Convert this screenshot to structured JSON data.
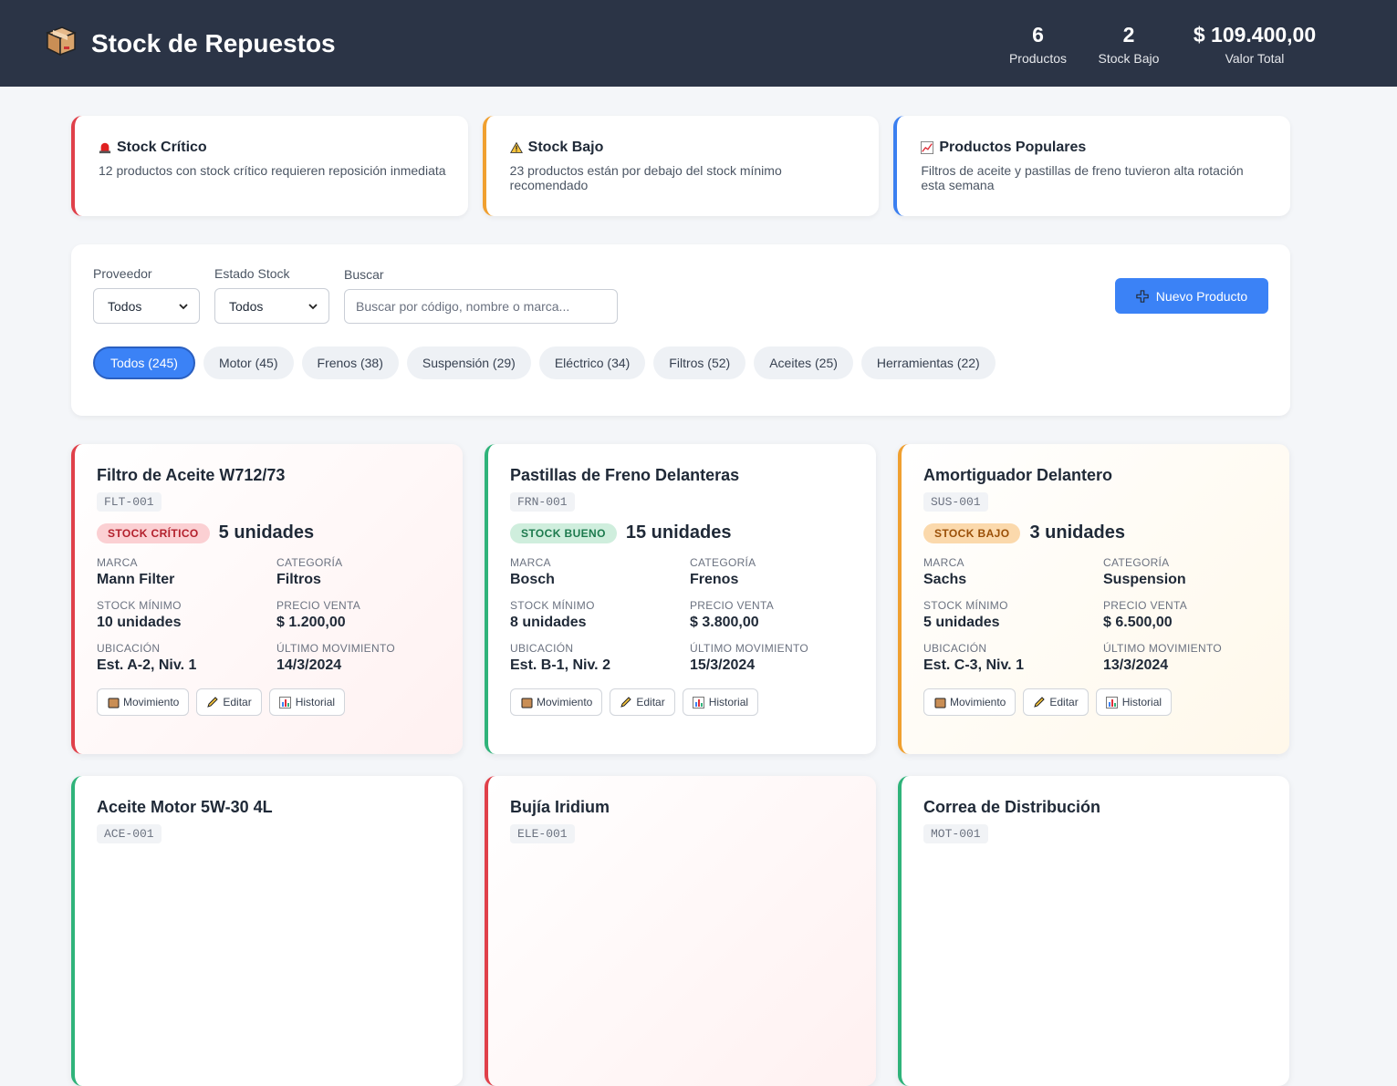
{
  "header": {
    "title": "Stock de Repuestos",
    "stats": [
      {
        "value": "6",
        "label": "Productos"
      },
      {
        "value": "2",
        "label": "Stock Bajo"
      },
      {
        "value": "$ 109.400,00",
        "label": "Valor Total"
      }
    ]
  },
  "alerts": [
    {
      "icon": "siren-icon",
      "title": "Stock Crítico",
      "text": "12 productos con stock crítico requieren reposición inmediata"
    },
    {
      "icon": "warning-icon",
      "title": "Stock Bajo",
      "text": "23 productos están por debajo del stock mínimo recomendado"
    },
    {
      "icon": "chart-up-icon",
      "title": "Productos Populares",
      "text": "Filtros de aceite y pastillas de freno tuvieron alta rotación esta semana"
    }
  ],
  "filters": {
    "provider_label": "Proveedor",
    "provider_value": "Todos",
    "stock_label": "Estado Stock",
    "stock_value": "Todos",
    "search_label": "Buscar",
    "search_placeholder": "Buscar por código, nombre o marca...",
    "new_button": "Nuevo Producto",
    "categories": [
      "Todos (245)",
      "Motor (45)",
      "Frenos (38)",
      "Suspensión (29)",
      "Eléctrico (34)",
      "Filtros (52)",
      "Aceites (25)",
      "Herramientas (22)"
    ]
  },
  "labels": {
    "brand": "MARCA",
    "category": "CATEGORÍA",
    "min_stock": "STOCK MÍNIMO",
    "price": "PRECIO VENTA",
    "location": "UBICACIÓN",
    "last_move": "ÚLTIMO MOVIMIENTO",
    "btn_move": "Movimiento",
    "btn_edit": "Editar",
    "btn_history": "Historial"
  },
  "products": [
    {
      "name": "Filtro de Aceite W712/73",
      "code": "FLT-001",
      "status": "STOCK CRÍTICO",
      "units": "5 unidades",
      "brand": "Mann Filter",
      "category": "Filtros",
      "min_stock": "10 unidades",
      "price": "$ 1.200,00",
      "location": "Est. A-2, Niv. 1",
      "last_move": "14/3/2024"
    },
    {
      "name": "Pastillas de Freno Delanteras",
      "code": "FRN-001",
      "status": "STOCK BUENO",
      "units": "15 unidades",
      "brand": "Bosch",
      "category": "Frenos",
      "min_stock": "8 unidades",
      "price": "$ 3.800,00",
      "location": "Est. B-1, Niv. 2",
      "last_move": "15/3/2024"
    },
    {
      "name": "Amortiguador Delantero",
      "code": "SUS-001",
      "status": "STOCK BAJO",
      "units": "3 unidades",
      "brand": "Sachs",
      "category": "Suspension",
      "min_stock": "5 unidades",
      "price": "$ 6.500,00",
      "location": "Est. C-3, Niv. 1",
      "last_move": "13/3/2024"
    },
    {
      "name": "Aceite Motor 5W-30 4L",
      "code": "ACE-001"
    },
    {
      "name": "Bujía Iridium",
      "code": "ELE-001"
    },
    {
      "name": "Correa de Distribución",
      "code": "MOT-001"
    }
  ]
}
